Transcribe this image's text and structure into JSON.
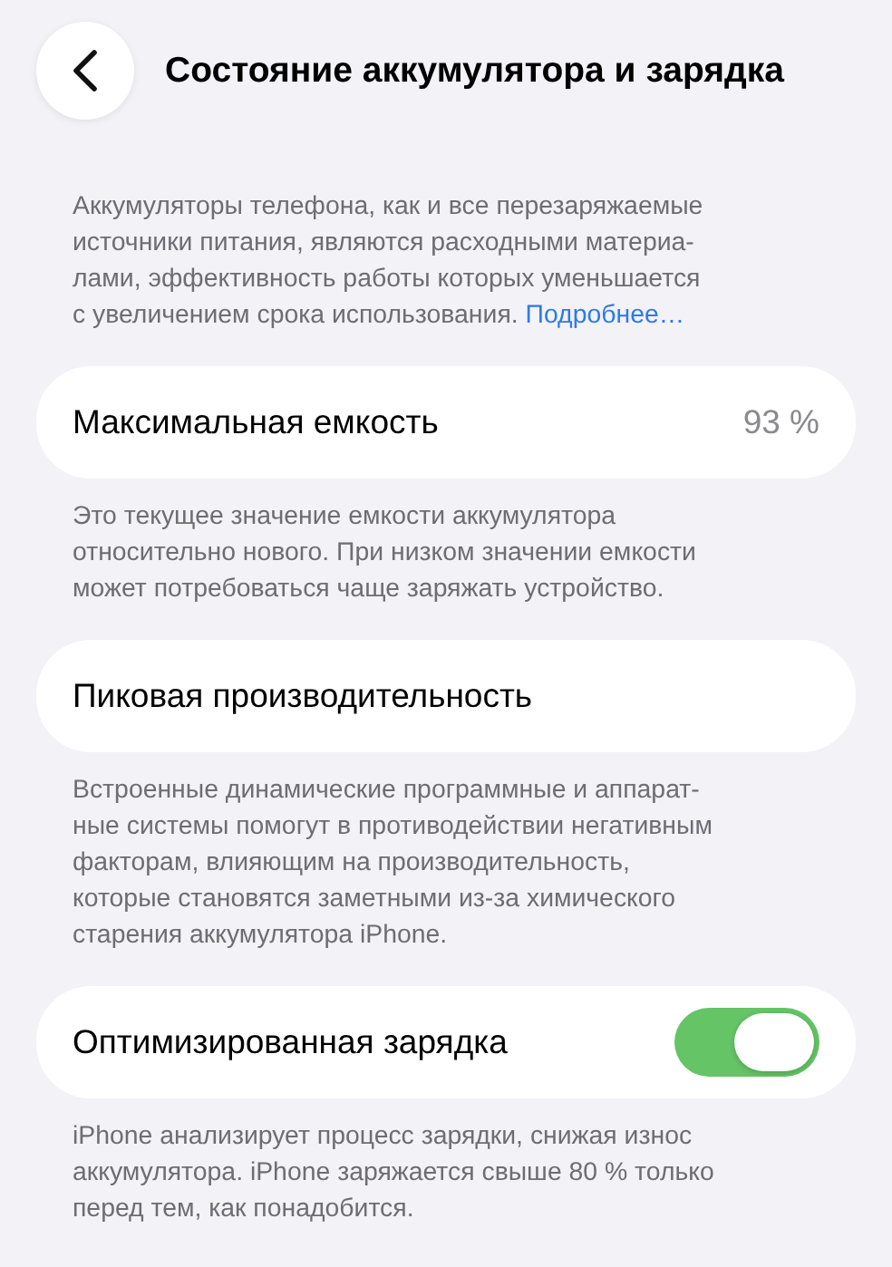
{
  "header": {
    "title": "Состояние аккумулятора и зарядка"
  },
  "intro": {
    "lines": [
      "Аккумуляторы телефона, как и все перезаряжаемые",
      "источники питания, являются расходными материа-",
      "лами, эффективность работы которых уменьшается",
      "с увеличением срока использования."
    ],
    "link": "Подробнее…"
  },
  "sections": [
    {
      "kind": "value",
      "label": "Максимальная емкость",
      "value": "93 %",
      "note": [
        "Это текущее значение емкости аккумулятора",
        "относительно нового. При низком значении емкости",
        "может потребоваться чаще заряжать устройство."
      ]
    },
    {
      "kind": "plain",
      "label": "Пиковая производительность",
      "note": [
        "Встроенные динамические программные и аппарат-",
        "ные системы помогут в противодействии негативным",
        "факторам, влияющим на производительность,",
        "которые становятся заметными из-за химического",
        "старения аккумулятора iPhone."
      ]
    },
    {
      "kind": "toggle",
      "label": "Оптимизированная зарядка",
      "on": true,
      "note": [
        "iPhone анализирует процесс зарядки, снижая износ",
        "аккумулятора. iPhone заряжается свыше 80 % только",
        "перед тем, как понадобится."
      ]
    }
  ]
}
